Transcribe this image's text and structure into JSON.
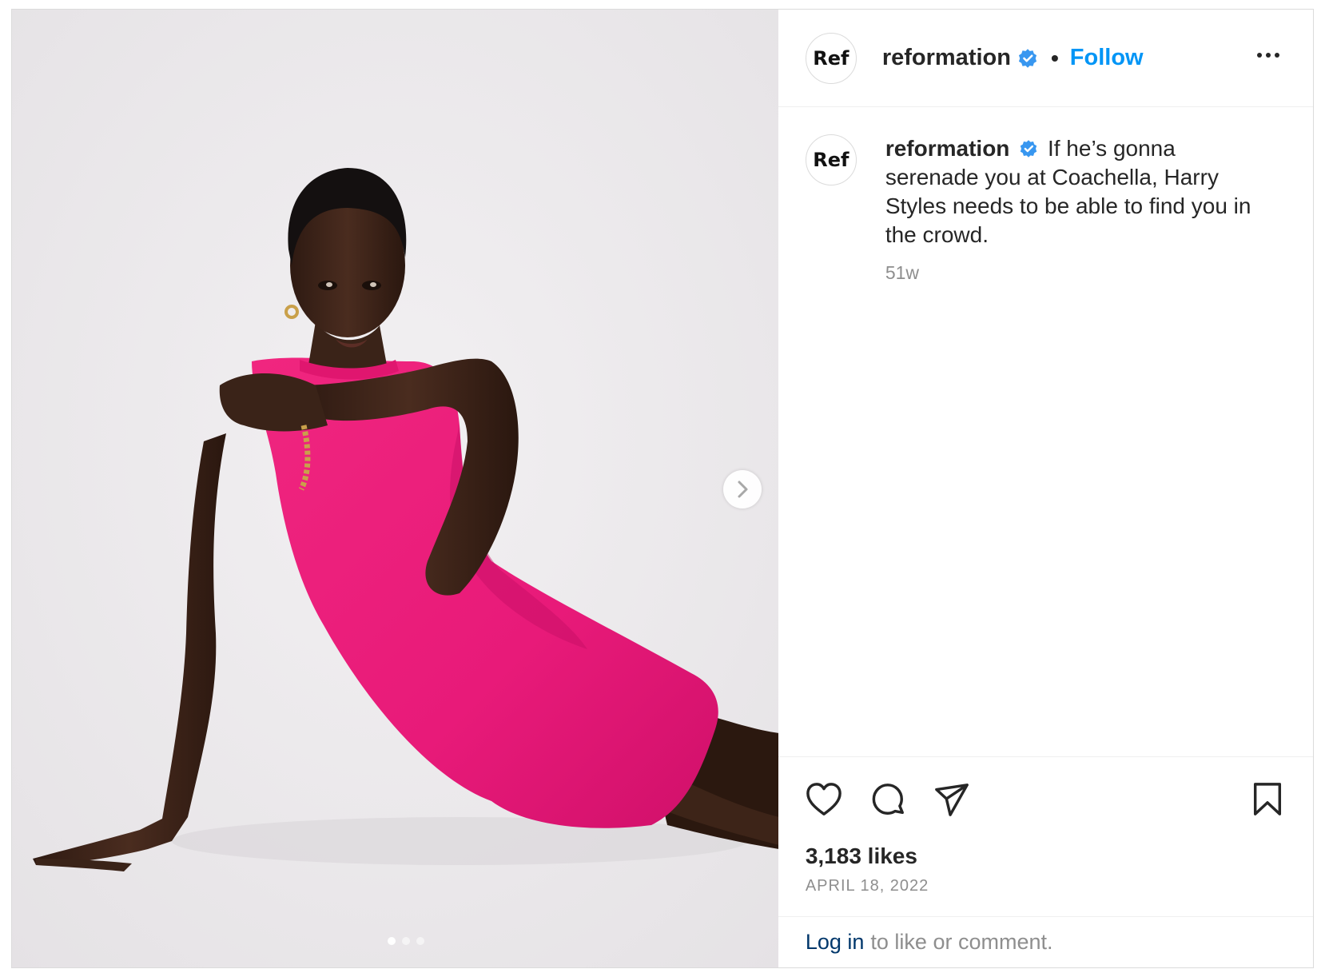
{
  "account": {
    "avatar_text": "Ref",
    "username": "reformation",
    "separator": "•",
    "follow_label": "Follow"
  },
  "caption": {
    "username": "reformation",
    "text": "If he’s gonna serenade you at Coachella, Harry Styles needs to be able to find you in the crowd.",
    "time_ago": "51w"
  },
  "post": {
    "likes": "3,183 likes",
    "date": "APRIL 18, 2022",
    "carousel_count": 3,
    "carousel_active": 1
  },
  "footer": {
    "login_link": "Log in",
    "login_suffix": "to like or comment."
  },
  "colors": {
    "accent": "#0095f6",
    "verified": "#3897f0",
    "dress": "#ea1a7f",
    "background": "#efedef"
  },
  "icons": [
    "verified-badge-icon",
    "more-options-icon",
    "chevron-right-icon",
    "heart-icon",
    "comment-icon",
    "share-icon",
    "bookmark-icon"
  ]
}
